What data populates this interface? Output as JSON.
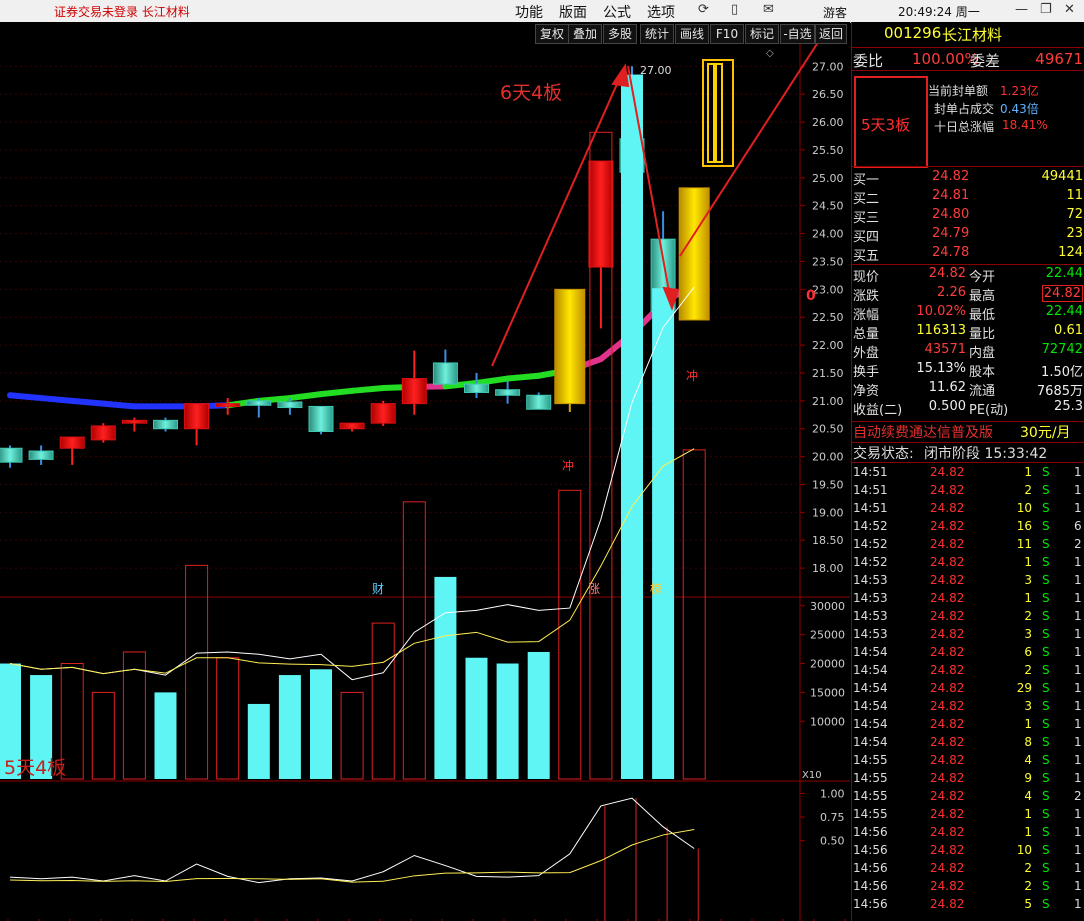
{
  "topbar": {
    "notice": "证券交易未登录",
    "stock_name": "长江材料",
    "menus": [
      "功能",
      "版面",
      "公式",
      "选项"
    ],
    "user_label": "游客",
    "clock": "20:49:24 周一",
    "icons": [
      "refresh-icon",
      "phone-icon",
      "mail-icon",
      "minimize-icon",
      "restore-icon",
      "close-icon"
    ]
  },
  "toolbar": {
    "buttons": [
      "复权",
      "叠加",
      "多股",
      "统计",
      "画线",
      "F10",
      "标记",
      "-自选",
      "返回"
    ]
  },
  "chart": {
    "annotation_top": "6天4板",
    "annotation_bottom": "5天4板",
    "peak_label": "27.00",
    "price_scale": [
      "27.00",
      "26.50",
      "26.00",
      "25.50",
      "25.00",
      "24.50",
      "24.00",
      "23.50",
      "23.00",
      "22.50",
      "22.00",
      "21.50",
      "21.00",
      "20.50",
      "20.00",
      "19.50",
      "19.00",
      "18.50",
      "18.00"
    ],
    "price_min": 17.5,
    "price_max": 27.4,
    "marker_cai": "财",
    "marker_zhang": "涨",
    "marker_bang": "榜",
    "marker_chong": "冲",
    "marker_zero": "0",
    "vol_scale": [
      "30000",
      "25000",
      "20000",
      "15000",
      "10000"
    ],
    "vol_multiplier": "X10",
    "ind_scale": [
      "1.00",
      "0.75",
      "0.50"
    ],
    "candles": [
      {
        "o": 20.15,
        "h": 20.2,
        "l": 19.8,
        "c": 19.9
      },
      {
        "o": 20.1,
        "h": 20.2,
        "l": 19.85,
        "c": 19.95
      },
      {
        "o": 20.15,
        "h": 20.35,
        "l": 19.85,
        "c": 20.35
      },
      {
        "o": 20.3,
        "h": 20.6,
        "l": 20.25,
        "c": 20.55
      },
      {
        "o": 20.6,
        "h": 20.7,
        "l": 20.45,
        "c": 20.65
      },
      {
        "o": 20.65,
        "h": 20.7,
        "l": 20.45,
        "c": 20.5
      },
      {
        "o": 20.5,
        "h": 20.95,
        "l": 20.2,
        "c": 20.95
      },
      {
        "o": 20.9,
        "h": 21.05,
        "l": 20.75,
        "c": 20.95
      },
      {
        "o": 21.0,
        "h": 21.05,
        "l": 20.7,
        "c": 20.92
      },
      {
        "o": 20.98,
        "h": 21.05,
        "l": 20.75,
        "c": 20.88
      },
      {
        "o": 20.9,
        "h": 20.9,
        "l": 20.4,
        "c": 20.45
      },
      {
        "o": 20.5,
        "h": 20.6,
        "l": 20.45,
        "c": 20.6
      },
      {
        "o": 20.6,
        "h": 21.0,
        "l": 20.55,
        "c": 20.95
      },
      {
        "o": 20.95,
        "h": 21.9,
        "l": 20.75,
        "c": 21.4
      },
      {
        "o": 21.68,
        "h": 21.92,
        "l": 21.3,
        "c": 21.3
      },
      {
        "o": 21.3,
        "h": 21.5,
        "l": 21.05,
        "c": 21.15
      },
      {
        "o": 21.2,
        "h": 21.35,
        "l": 20.95,
        "c": 21.1
      },
      {
        "o": 21.1,
        "h": 21.15,
        "l": 20.9,
        "c": 20.85
      },
      {
        "o": 20.95,
        "h": 23.0,
        "l": 20.8,
        "c": 23.0
      },
      {
        "o": 23.4,
        "h": 25.3,
        "l": 22.3,
        "c": 25.3
      },
      {
        "o": 25.7,
        "h": 27.0,
        "l": 24.4,
        "c": 25.1
      },
      {
        "o": 23.9,
        "h": 24.4,
        "l": 22.6,
        "c": 22.6
      },
      {
        "o": 22.45,
        "h": 24.82,
        "l": 22.45,
        "c": 24.82
      }
    ],
    "volumes": [
      2000,
      1800,
      2000,
      1500,
      2200,
      1500,
      3700,
      2100,
      1300,
      1800,
      1900,
      1500,
      2700,
      4800,
      3500,
      2100,
      2000,
      2200,
      5000,
      11200,
      12200,
      8500,
      5700
    ],
    "ma_line": [
      21.1,
      21.05,
      21.0,
      20.95,
      20.9,
      20.9,
      20.9,
      20.92,
      21.0,
      21.05,
      21.12,
      21.18,
      21.23,
      21.25,
      21.26,
      21.32,
      21.4,
      21.45,
      21.55,
      21.75,
      22.2,
      22.75,
      23.1
    ]
  },
  "panel": {
    "code": "001296",
    "name": "长江材料",
    "weibi_label": "委比",
    "weibi_value": "100.00%",
    "weicha_label": "委差",
    "weicha_value": "49671",
    "box_label": "5天3板",
    "seal_amount_label": "当前封单额",
    "seal_amount_value": "1.23亿",
    "seal_ratio_label": "封单占成交",
    "seal_ratio_value": "0.43倍",
    "ten_day_label": "十日总涨幅",
    "ten_day_value": "18.41%",
    "bids": [
      {
        "label": "买一",
        "price": "24.82",
        "vol": "49441"
      },
      {
        "label": "买二",
        "price": "24.81",
        "vol": "11"
      },
      {
        "label": "买三",
        "price": "24.80",
        "vol": "72"
      },
      {
        "label": "买四",
        "price": "24.79",
        "vol": "23"
      },
      {
        "label": "买五",
        "price": "24.78",
        "vol": "124"
      }
    ],
    "stats": [
      {
        "l1": "现价",
        "v1": "24.82",
        "l2": "今开",
        "v2": "22.44"
      },
      {
        "l1": "涨跌",
        "v1": "2.26",
        "l2": "最高",
        "v2": "24.82"
      },
      {
        "l1": "涨幅",
        "v1": "10.02%",
        "l2": "最低",
        "v2": "22.44"
      },
      {
        "l1": "总量",
        "v1": "116313",
        "l2": "量比",
        "v2": "0.61"
      },
      {
        "l1": "外盘",
        "v1": "43571",
        "l2": "内盘",
        "v2": "72742"
      },
      {
        "l1": "换手",
        "v1": "15.13%",
        "l2": "股本",
        "v2": "1.50亿"
      },
      {
        "l1": "净资",
        "v1": "11.62",
        "l2": "流通",
        "v2": "7685万"
      },
      {
        "l1": "收益(二)",
        "v1": "0.500",
        "l2": "PE(动)",
        "v2": "25.3"
      }
    ],
    "promo": "自动续费通达信普及版",
    "promo_price": "30元/月",
    "status_label": "交易状态:",
    "status_value": "闭市阶段 15:33:42",
    "ticks": [
      {
        "t": "14:51",
        "p": "24.82",
        "v": "1",
        "s": "S",
        "n": "1"
      },
      {
        "t": "14:51",
        "p": "24.82",
        "v": "2",
        "s": "S",
        "n": "1"
      },
      {
        "t": "14:51",
        "p": "24.82",
        "v": "10",
        "s": "S",
        "n": "1"
      },
      {
        "t": "14:52",
        "p": "24.82",
        "v": "16",
        "s": "S",
        "n": "6"
      },
      {
        "t": "14:52",
        "p": "24.82",
        "v": "11",
        "s": "S",
        "n": "2"
      },
      {
        "t": "14:52",
        "p": "24.82",
        "v": "1",
        "s": "S",
        "n": "1"
      },
      {
        "t": "14:53",
        "p": "24.82",
        "v": "3",
        "s": "S",
        "n": "1"
      },
      {
        "t": "14:53",
        "p": "24.82",
        "v": "1",
        "s": "S",
        "n": "1"
      },
      {
        "t": "14:53",
        "p": "24.82",
        "v": "2",
        "s": "S",
        "n": "1"
      },
      {
        "t": "14:53",
        "p": "24.82",
        "v": "3",
        "s": "S",
        "n": "1"
      },
      {
        "t": "14:54",
        "p": "24.82",
        "v": "6",
        "s": "S",
        "n": "1"
      },
      {
        "t": "14:54",
        "p": "24.82",
        "v": "2",
        "s": "S",
        "n": "1"
      },
      {
        "t": "14:54",
        "p": "24.82",
        "v": "29",
        "s": "S",
        "n": "1"
      },
      {
        "t": "14:54",
        "p": "24.82",
        "v": "3",
        "s": "S",
        "n": "1"
      },
      {
        "t": "14:54",
        "p": "24.82",
        "v": "1",
        "s": "S",
        "n": "1"
      },
      {
        "t": "14:54",
        "p": "24.82",
        "v": "8",
        "s": "S",
        "n": "1"
      },
      {
        "t": "14:55",
        "p": "24.82",
        "v": "4",
        "s": "S",
        "n": "1"
      },
      {
        "t": "14:55",
        "p": "24.82",
        "v": "9",
        "s": "S",
        "n": "1"
      },
      {
        "t": "14:55",
        "p": "24.82",
        "v": "4",
        "s": "S",
        "n": "2"
      },
      {
        "t": "14:55",
        "p": "24.82",
        "v": "1",
        "s": "S",
        "n": "1"
      },
      {
        "t": "14:56",
        "p": "24.82",
        "v": "1",
        "s": "S",
        "n": "1"
      },
      {
        "t": "14:56",
        "p": "24.82",
        "v": "10",
        "s": "S",
        "n": "1"
      },
      {
        "t": "14:56",
        "p": "24.82",
        "v": "2",
        "s": "S",
        "n": "1"
      },
      {
        "t": "14:56",
        "p": "24.82",
        "v": "2",
        "s": "S",
        "n": "1"
      },
      {
        "t": "14:56",
        "p": "24.82",
        "v": "5",
        "s": "S",
        "n": "1"
      }
    ]
  }
}
